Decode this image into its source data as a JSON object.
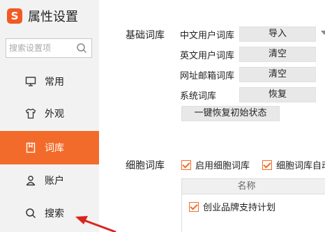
{
  "app": {
    "title": "属性设置",
    "logo": "S"
  },
  "search": {
    "placeholder": "搜索设置项"
  },
  "sidebar": {
    "items": [
      {
        "label": "常用",
        "icon": "monitor-icon"
      },
      {
        "label": "外观",
        "icon": "tshirt-icon"
      },
      {
        "label": "词库",
        "icon": "book-icon",
        "active": true
      },
      {
        "label": "账户",
        "icon": "user-icon"
      },
      {
        "label": "搜索",
        "icon": "search-icon"
      }
    ]
  },
  "lexicon": {
    "section_label": "基础词库",
    "rows": [
      {
        "label": "中文用户词库",
        "button": "导入"
      },
      {
        "label": "英文用户词库",
        "button": "清空"
      },
      {
        "label": "网址邮箱词库",
        "button": "清空"
      },
      {
        "label": "系统词库",
        "button": "恢复"
      }
    ],
    "reset_button": "一键恢复初始状态"
  },
  "cell_lexicon": {
    "section_label": "细胞词库",
    "option1": "启用细胞词库",
    "option2": "细胞词库自动",
    "table_header": "名称",
    "rows": [
      {
        "label": "创业品牌支持计划",
        "checked": true
      }
    ]
  },
  "colors": {
    "accent": "#f36b2a",
    "sidebar_bg": "#f2f2f2",
    "button_bg": "#e8e8e8"
  }
}
